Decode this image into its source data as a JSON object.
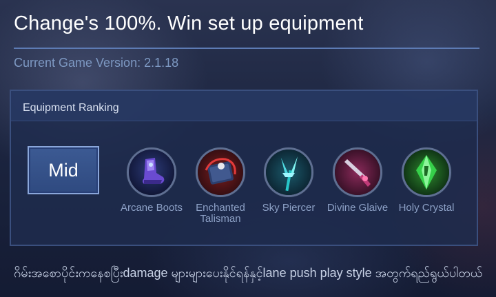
{
  "header": {
    "title": "Change's 100%. Win set up equipment",
    "version": "Current Game Version: 2.1.18"
  },
  "panel": {
    "heading": "Equipment Ranking",
    "lane": "Mid",
    "items": [
      {
        "name": "Arcane Boots",
        "icon": "arcane-boots-icon",
        "color": "#6a4bd1"
      },
      {
        "name": "Enchanted Talisman",
        "icon": "enchanted-talisman-icon",
        "color": "#c0392b"
      },
      {
        "name": "Sky Piercer",
        "icon": "sky-piercer-icon",
        "color": "#27c7c9"
      },
      {
        "name": "Divine Glaive",
        "icon": "divine-glaive-icon",
        "color": "#c03a78"
      },
      {
        "name": "Holy Crystal",
        "icon": "holy-crystal-icon",
        "color": "#36d04a"
      }
    ]
  },
  "footer": {
    "note": "ဂိမ်းအစောပိုင်းကနေစပြီးdamage များများပေးနိုင်ရန်နှင့်lane push play style အတွက်ရည်ရွယ်ပါတယ်"
  }
}
